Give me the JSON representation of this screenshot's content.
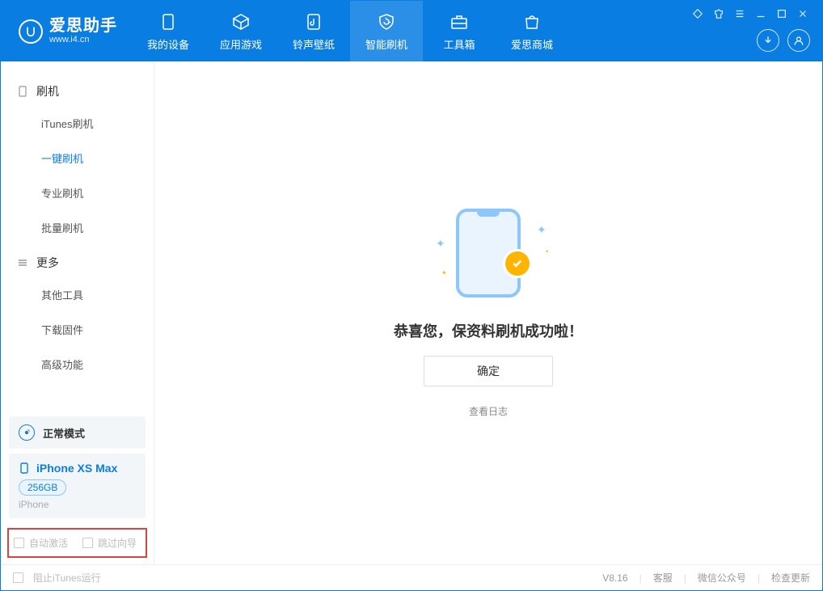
{
  "app": {
    "name": "爱思助手",
    "domain": "www.i4.cn"
  },
  "nav": {
    "items": [
      {
        "label": "我的设备"
      },
      {
        "label": "应用游戏"
      },
      {
        "label": "铃声壁纸"
      },
      {
        "label": "智能刷机"
      },
      {
        "label": "工具箱"
      },
      {
        "label": "爱思商城"
      }
    ],
    "active_index": 3
  },
  "sidebar": {
    "groups": [
      {
        "title": "刷机",
        "items": [
          "iTunes刷机",
          "一键刷机",
          "专业刷机",
          "批量刷机"
        ],
        "active_index": 1
      },
      {
        "title": "更多",
        "items": [
          "其他工具",
          "下载固件",
          "高级功能"
        ],
        "active_index": -1
      }
    ],
    "mode": {
      "label": "正常模式"
    },
    "device": {
      "name": "iPhone XS Max",
      "storage": "256GB",
      "type": "iPhone"
    },
    "red_box": {
      "auto_activate": "自动激活",
      "skip_guide": "跳过向导"
    }
  },
  "main": {
    "message": "恭喜您，保资料刷机成功啦！",
    "ok_label": "确定",
    "log_link": "查看日志"
  },
  "statusbar": {
    "block_itunes": "阻止iTunes运行",
    "version": "V8.16",
    "links": [
      "客服",
      "微信公众号",
      "检查更新"
    ]
  }
}
